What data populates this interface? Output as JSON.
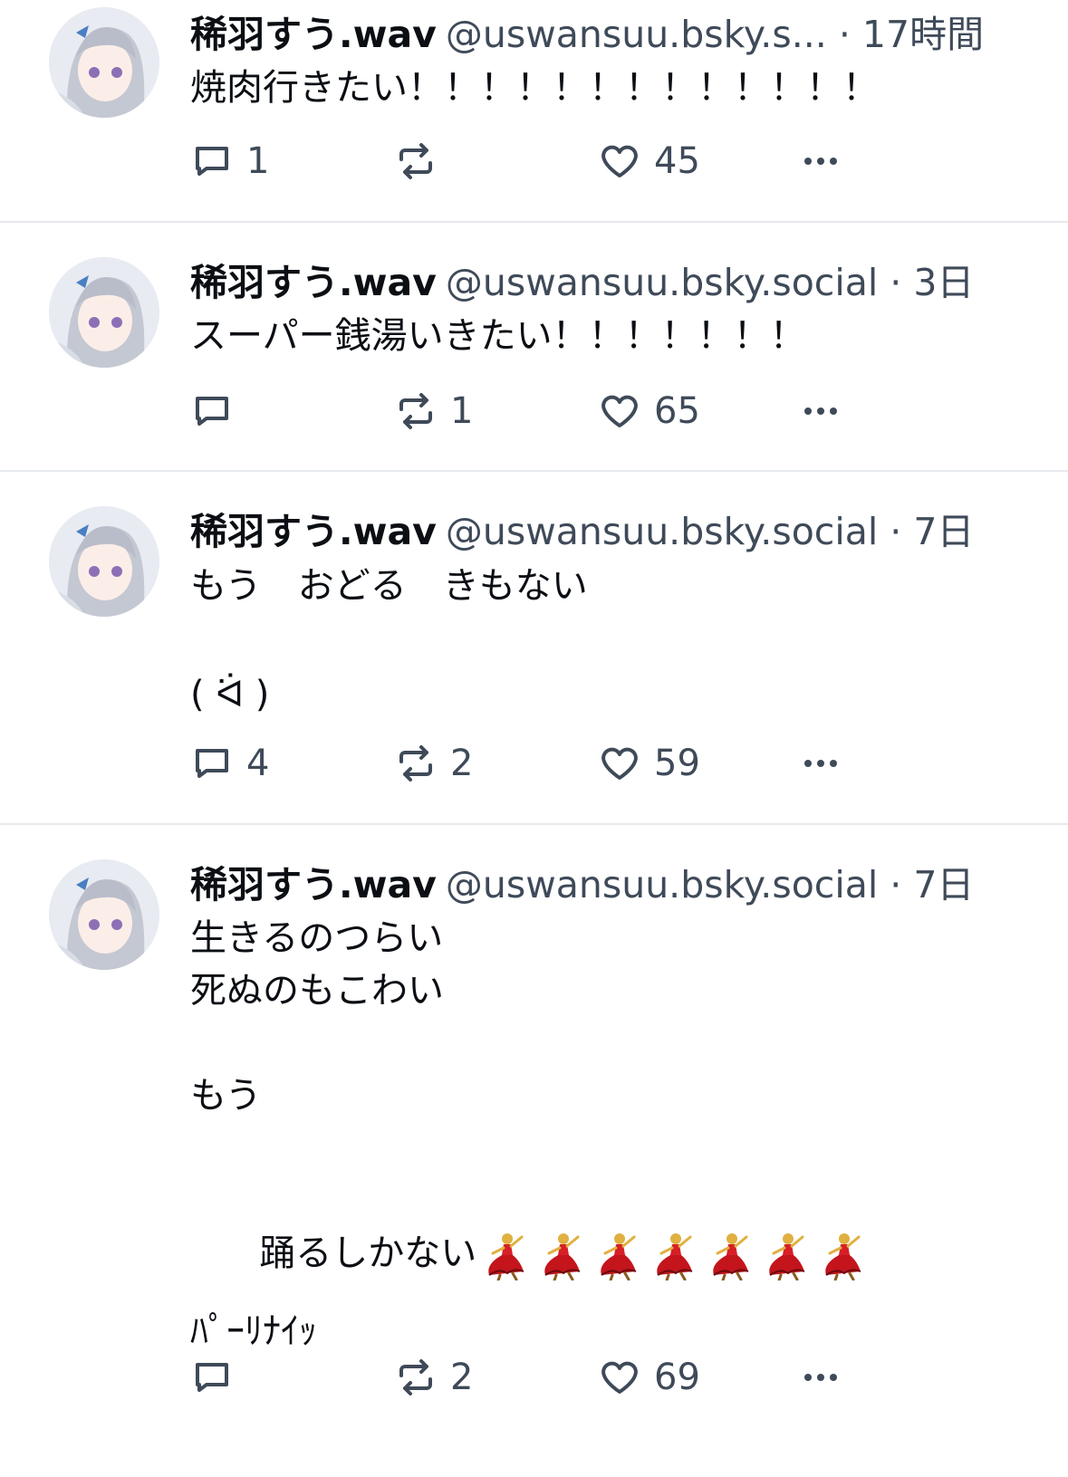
{
  "posts": [
    {
      "author_name": "稀羽すう.wav",
      "handle": "@uswansuu.bsky.s...",
      "time": "· 17時間",
      "text": "焼肉行きたい！！！！！！！！！！！！！",
      "reply_count": "1",
      "repost_count": "",
      "like_count": "45"
    },
    {
      "author_name": "稀羽すう.wav",
      "handle": "@uswansuu.bsky.social",
      "time": "· 3日",
      "text": "スーパー銭湯いきたい！！！！！！！",
      "reply_count": "",
      "repost_count": "1",
      "like_count": "65"
    },
    {
      "author_name": "稀羽すう.wav",
      "handle": "@uswansuu.bsky.social",
      "time": "· 7日",
      "text": "もう　おどる　きもない\n\n( ᐛ )",
      "reply_count": "4",
      "repost_count": "2",
      "like_count": "59"
    },
    {
      "author_name": "稀羽すう.wav",
      "handle": "@uswansuu.bsky.social",
      "time": "· 7日",
      "text_top": "生きるのつらい\n死ぬのもこわい\n\nもう\n\n",
      "text_line": "踊るしかない",
      "emoji_count": 7,
      "emoji_name": "dancer-emoji",
      "text_bottom": "\nﾊﾟｰﾘﾅｲｯ",
      "reply_count": "",
      "repost_count": "2",
      "like_count": "69"
    }
  ],
  "icons": {
    "reply": "reply-icon",
    "repost": "repost-icon",
    "like": "heart-icon",
    "more": "more-icon"
  },
  "colors": {
    "text": "#0b0f14",
    "muted": "#3f4a59",
    "divider": "#e6e9ed"
  }
}
